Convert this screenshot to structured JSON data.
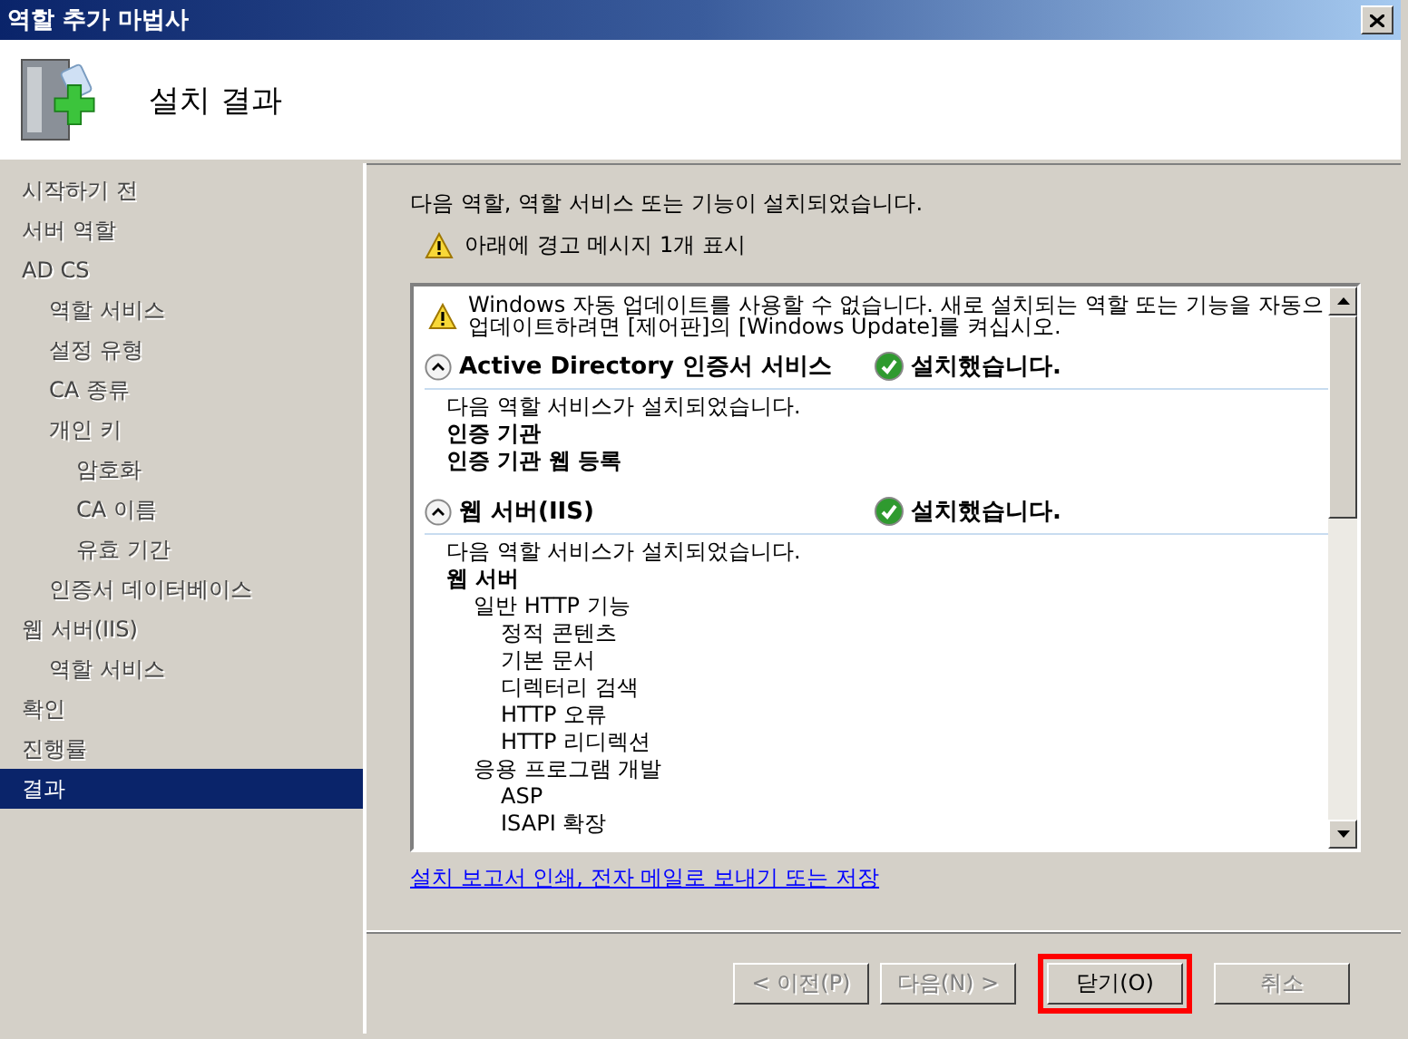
{
  "window": {
    "title": "역할 추가 마법사"
  },
  "header": {
    "title": "설치 결과"
  },
  "steps": [
    {
      "label": "시작하기 전",
      "selected": false
    },
    {
      "label": "서버 역할",
      "selected": false
    },
    {
      "label": "AD CS",
      "selected": false,
      "children": [
        {
          "label": "역할 서비스",
          "selected": false
        },
        {
          "label": "설정 유형",
          "selected": false
        },
        {
          "label": "CA 종류",
          "selected": false
        },
        {
          "label": "개인 키",
          "selected": false,
          "children": [
            {
              "label": "암호화",
              "selected": false
            },
            {
              "label": "CA 이름",
              "selected": false
            },
            {
              "label": "유효 기간",
              "selected": false
            }
          ]
        },
        {
          "label": "인증서 데이터베이스",
          "selected": false
        }
      ]
    },
    {
      "label": "웹 서버(IIS)",
      "selected": false,
      "children": [
        {
          "label": "역할 서비스",
          "selected": false
        }
      ]
    },
    {
      "label": "확인",
      "selected": false
    },
    {
      "label": "진행률",
      "selected": false
    },
    {
      "label": "결과",
      "selected": true
    }
  ],
  "summary": "다음 역할, 역할 서비스 또는 기능이 설치되었습니다.",
  "warning_summary": "아래에 경고 메시지 1개 표시",
  "warning_lines": [
    "Windows 자동 업데이트를 사용할 수 없습니다. 새로 설치되는 역할 또는 기능을 자동으",
    "업데이트하려면 [제어판]의 [Windows Update]를 켜십시오."
  ],
  "sections": [
    {
      "title": "Active Directory 인증서 서비스",
      "expanded": true,
      "status": "설치했습니다.",
      "kind": "success",
      "intro": "다음 역할 서비스가 설치되었습니다.",
      "services": [
        {
          "label": "인증 기관"
        },
        {
          "label": "인증 기관 웹 등록"
        }
      ]
    },
    {
      "title": "웹 서버(IIS)",
      "expanded": true,
      "status": "설치했습니다.",
      "kind": "success",
      "intro": "다음 역할 서비스가 설치되었습니다.",
      "services": [
        {
          "label": "웹 서버",
          "children": [
            {
              "label": "일반 HTTP 기능",
              "children": [
                {
                  "label": "정적 콘텐츠"
                },
                {
                  "label": "기본 문서"
                },
                {
                  "label": "디렉터리 검색"
                },
                {
                  "label": "HTTP 오류"
                },
                {
                  "label": "HTTP 리디렉션"
                }
              ]
            },
            {
              "label": "응용 프로그램 개발",
              "children": [
                {
                  "label": "ASP"
                },
                {
                  "label": "ISAPI 확장"
                }
              ]
            }
          ]
        }
      ]
    }
  ],
  "link": "설치 보고서 인쇄, 전자 메일로 보내기 또는 저장",
  "buttons": [
    {
      "label": "< 이전(P)",
      "disabled": true,
      "highlighted": false
    },
    {
      "label": "다음(N) >",
      "disabled": true,
      "highlighted": false
    },
    {
      "label": "닫기(O)",
      "disabled": false,
      "highlighted": true
    },
    {
      "label": "취소",
      "disabled": true,
      "highlighted": false
    }
  ]
}
